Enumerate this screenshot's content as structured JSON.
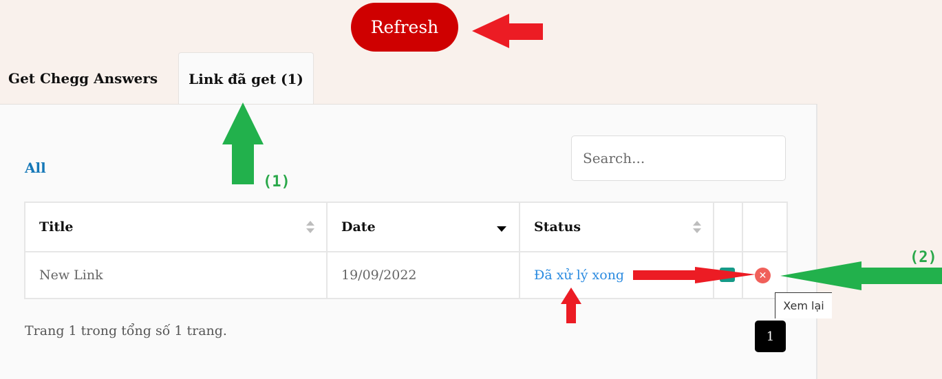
{
  "toolbar": {
    "refresh_label": "Refresh"
  },
  "tabs": [
    {
      "label": "Get Chegg Answers",
      "active": false
    },
    {
      "label": "Link đã get (1)",
      "active": true
    }
  ],
  "filters": {
    "all_label": "All"
  },
  "search": {
    "placeholder": "Search...",
    "value": ""
  },
  "table": {
    "columns": [
      {
        "label": "Title",
        "sort": "none"
      },
      {
        "label": "Date",
        "sort": "desc"
      },
      {
        "label": "Status",
        "sort": "none"
      },
      {
        "label": ""
      },
      {
        "label": ""
      }
    ],
    "rows": [
      {
        "title": "New Link",
        "date": "19/09/2022",
        "status": "Đã xử lý xong",
        "actions": [
          "review-icon",
          "delete-icon"
        ]
      }
    ]
  },
  "tooltip": {
    "text": "Xem lại"
  },
  "pagination": {
    "info": "Trang 1 trong tổng số 1 trang.",
    "current_page": "1"
  },
  "annotations": {
    "label_1": "(1)",
    "label_2": "(2)"
  },
  "colors": {
    "refresh_bg": "#cf0000",
    "link_blue": "#1578b8",
    "status_blue": "#2b8be0",
    "annotation_red": "#ec1c24",
    "annotation_green": "#22b14c",
    "delete_red": "#f0605a",
    "review_teal": "#169a88"
  }
}
